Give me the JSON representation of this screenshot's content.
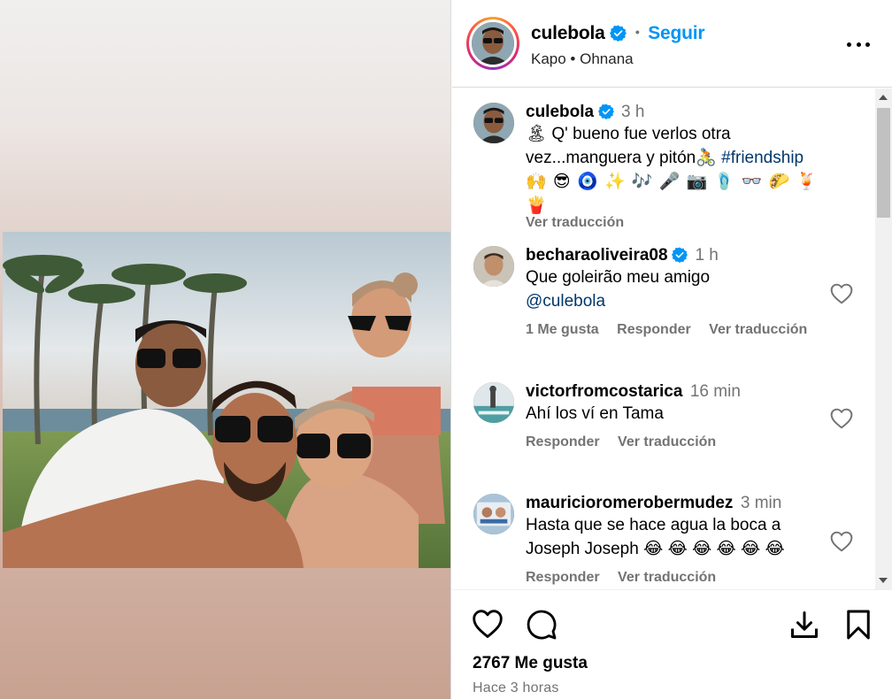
{
  "post": {
    "username": "culebola",
    "follow_label": "Seguir",
    "music": "Kapo • Ohnana",
    "more_icon": "more-horizontal-icon"
  },
  "caption": {
    "username": "culebola",
    "time": "3 h",
    "text_prefix": "🏝 Q' bueno fue verlos otra vez...manguera y pitón🚴 ",
    "hashtag": "#friendship",
    "emoji_line": "🙌 😎 🧿 ✨ 🎶 🎤 📷 🩴 👓 🌮 🍹 🍟",
    "translate": "Ver traducción"
  },
  "comments": [
    {
      "username": "becharaoliveira08",
      "verified": true,
      "time": "1 h",
      "text": "Que goleirão meu amigo",
      "mention": "@culebola",
      "likes": "1 Me gusta",
      "reply": "Responder",
      "translate": "Ver traducción"
    },
    {
      "username": "victorfromcostarica",
      "verified": false,
      "time": "16 min",
      "text": "Ahí los ví en Tama",
      "reply": "Responder",
      "translate": "Ver traducción"
    },
    {
      "username": "mauricioromerobermudez",
      "verified": false,
      "time": "3 min",
      "text": "Hasta que se hace agua la boca a Joseph Joseph 😂 😂 😂 😂 😂 😂",
      "reply": "Responder",
      "translate": "Ver traducción"
    }
  ],
  "footer": {
    "likes": "2767 Me gusta",
    "time_ago": "Hace 3 horas"
  },
  "colors": {
    "accent": "#0095f6",
    "secondary_text": "#737373",
    "link": "#00376b"
  }
}
